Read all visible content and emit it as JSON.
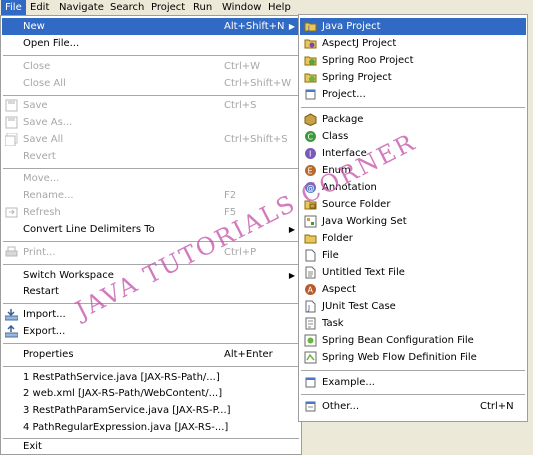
{
  "menubar": [
    "File",
    "Edit",
    "Navigate",
    "Search",
    "Project",
    "Run",
    "Window",
    "Help"
  ],
  "file_menu": {
    "new": {
      "label": "New",
      "shortcut": "Alt+Shift+N"
    },
    "open_file": "Open File...",
    "close": {
      "label": "Close",
      "shortcut": "Ctrl+W"
    },
    "close_all": {
      "label": "Close All",
      "shortcut": "Ctrl+Shift+W"
    },
    "save": {
      "label": "Save",
      "shortcut": "Ctrl+S"
    },
    "save_as": "Save As...",
    "save_all": {
      "label": "Save All",
      "shortcut": "Ctrl+Shift+S"
    },
    "revert": "Revert",
    "move": "Move...",
    "rename": {
      "label": "Rename...",
      "shortcut": "F2"
    },
    "refresh": {
      "label": "Refresh",
      "shortcut": "F5"
    },
    "convert": "Convert Line Delimiters To",
    "print": {
      "label": "Print...",
      "shortcut": "Ctrl+P"
    },
    "switch_workspace": "Switch Workspace",
    "restart": "Restart",
    "import": "Import...",
    "export": "Export...",
    "properties": {
      "label": "Properties",
      "shortcut": "Alt+Enter"
    },
    "recent": [
      "1 RestPathService.java  [JAX-RS-Path/...]",
      "2 web.xml  [JAX-RS-Path/WebContent/...]",
      "3 RestPathParamService.java  [JAX-RS-P...]",
      "4 PathRegularExpression.java  [JAX-RS-...]"
    ],
    "exit": "Exit"
  },
  "new_menu": {
    "items": [
      "Java Project",
      "AspectJ Project",
      "Spring Roo Project",
      "Spring Project",
      "Project...",
      "Package",
      "Class",
      "Interface",
      "Enum",
      "Annotation",
      "Source Folder",
      "Java Working Set",
      "Folder",
      "File",
      "Untitled Text File",
      "Aspect",
      "JUnit Test Case",
      "Task",
      "Spring Bean Configuration File",
      "Spring Web Flow Definition File",
      "Example...",
      "Other..."
    ],
    "other_shortcut": "Ctrl+N"
  },
  "watermark": "JAVA TUTORIALS CORNER",
  "colors": {
    "selection": "#316ac5",
    "background": "#ece9d8",
    "disabled": "#a7a6aa"
  }
}
